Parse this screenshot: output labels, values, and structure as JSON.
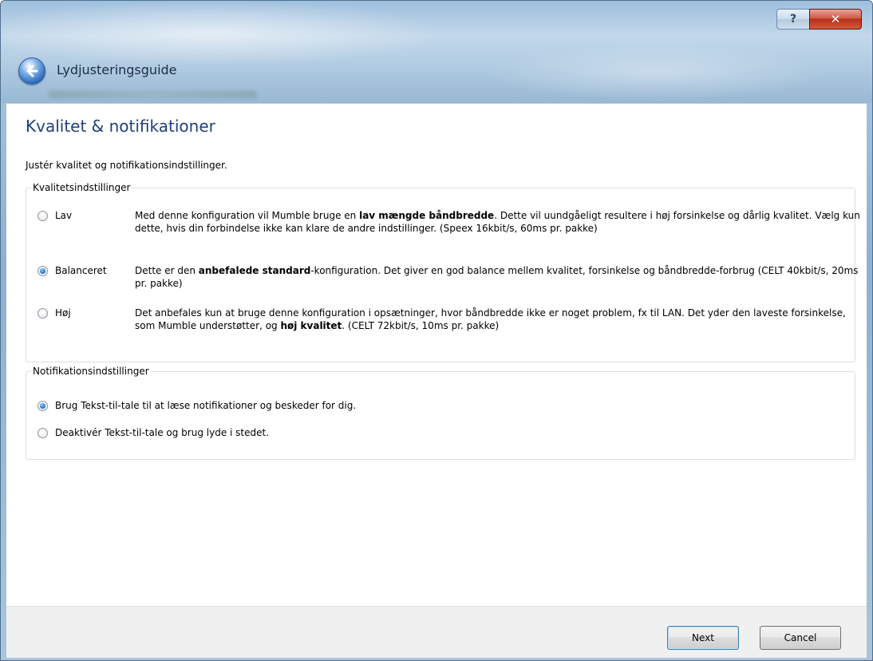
{
  "window": {
    "title": "Lydjusteringsguide",
    "help_label": "?",
    "close_label": "✕"
  },
  "page": {
    "title": "Kvalitet & notifikationer",
    "subtitle": "Justér kvalitet og notifikationsindstillinger."
  },
  "quality": {
    "legend": "Kvalitetsindstillinger",
    "options": [
      {
        "label": "Lav",
        "checked": false,
        "desc_pre": "Med denne konfiguration vil Mumble bruge en ",
        "desc_bold": "lav mængde båndbredde",
        "desc_post": ". Dette vil uundgåeligt resultere i høj forsinkelse og dårlig kvalitet. Vælg kun dette, hvis din forbindelse ikke kan klare de andre indstillinger. (Speex 16kbit/s, 60ms pr. pakke)"
      },
      {
        "label": "Balanceret",
        "checked": true,
        "desc_pre": "Dette er den ",
        "desc_bold": "anbefalede standard",
        "desc_post": "-konfiguration. Det giver en god balance mellem kvalitet, forsinkelse og båndbredde-forbrug (CELT 40kbit/s, 20ms pr. pakke)"
      },
      {
        "label": "Høj",
        "checked": false,
        "desc_pre": "Det anbefales kun at bruge denne konfiguration i opsætninger, hvor båndbredde ikke er noget problem, fx til LAN. Det yder den laveste forsinkelse, som Mumble understøtter, og ",
        "desc_bold": "høj kvalitet",
        "desc_post": ". (CELT 72kbit/s, 10ms pr. pakke)"
      }
    ]
  },
  "notifications": {
    "legend": "Notifikationsindstillinger",
    "options": [
      {
        "label": "Brug Tekst-til-tale til at læse notifikationer og beskeder for dig.",
        "checked": true
      },
      {
        "label": "Deaktivér Tekst-til-tale og brug lyde i stedet.",
        "checked": false
      }
    ]
  },
  "footer": {
    "next_label": "Next",
    "cancel_label": "Cancel"
  },
  "colors": {
    "title_blue": "#1f3f7a",
    "close_red": "#c9432b",
    "frame_blue": "#98b8d4"
  }
}
